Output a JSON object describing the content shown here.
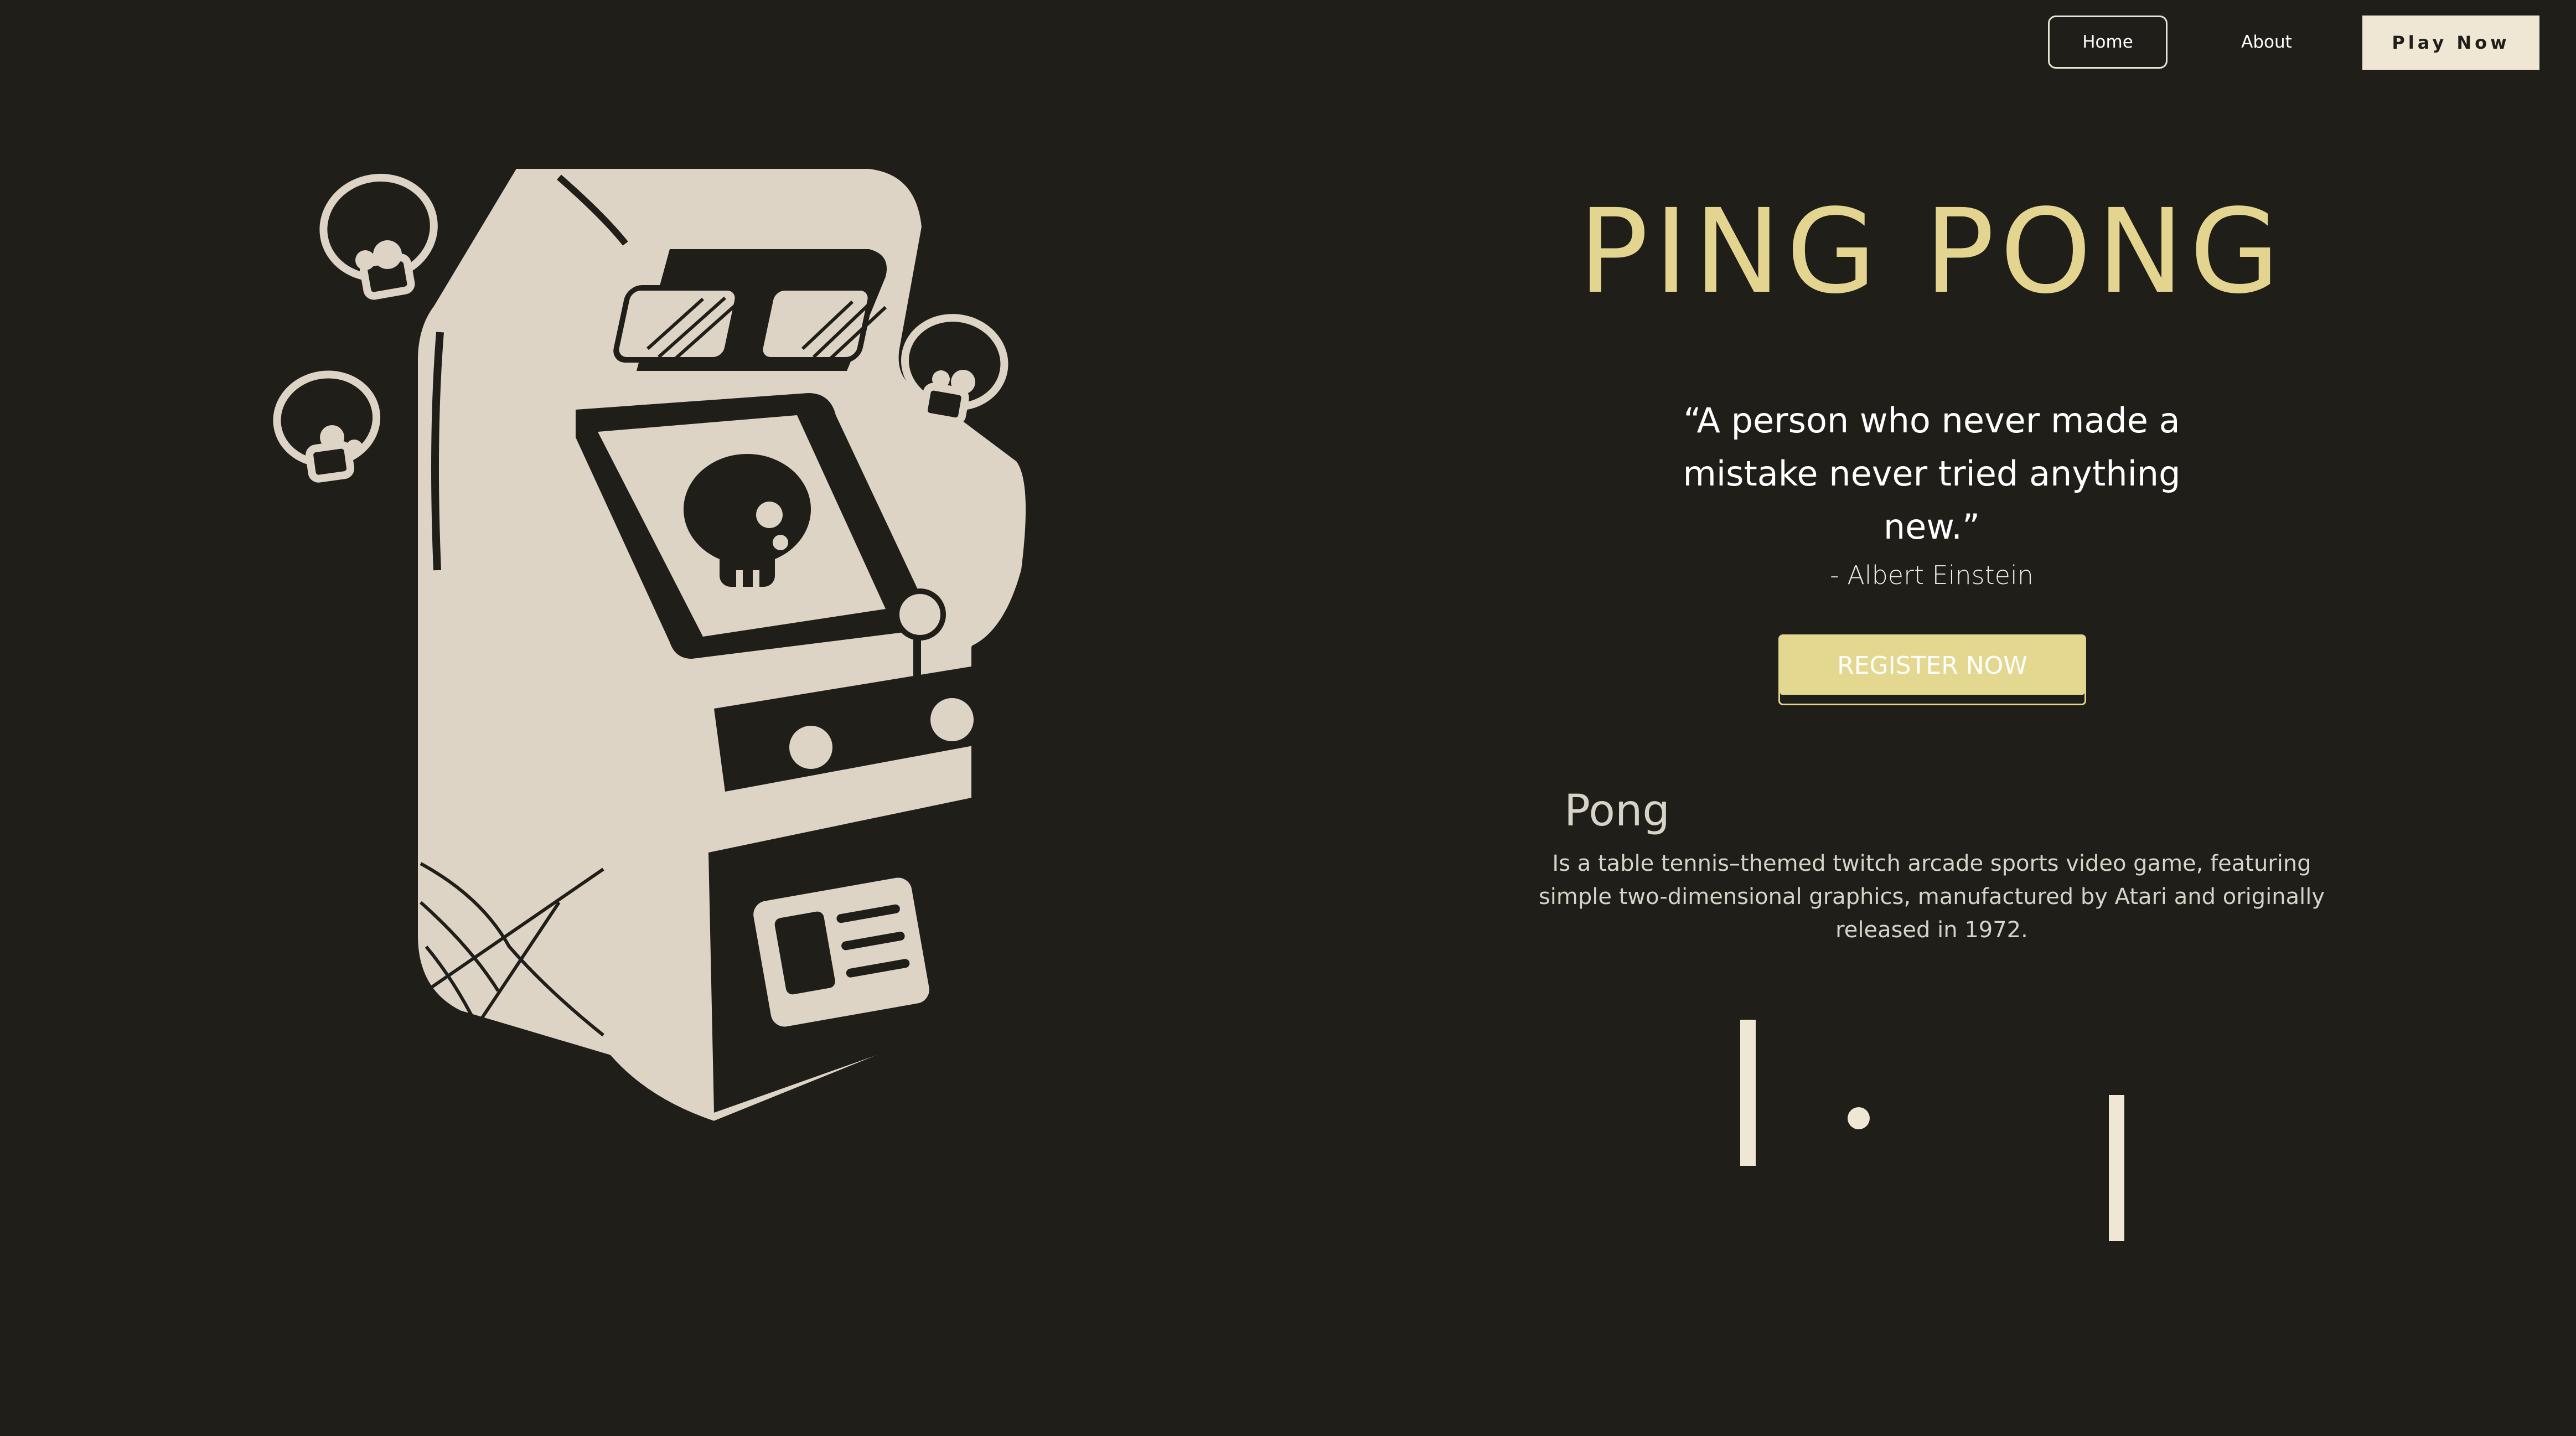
{
  "nav": {
    "home": "Home",
    "about": "About",
    "play": "Play Now"
  },
  "hero": {
    "title": "PING PONG",
    "quote": "“A person who never made a mistake never tried anything new.”",
    "author": "- Albert Einstein",
    "register_label": "REGISTER NOW"
  },
  "section": {
    "title": "Pong",
    "description": "Is a table tennis–themed twitch arcade sports video game, featuring simple two-dimensional graphics, manufactured by Atari and originally released in 1972."
  },
  "illustration": {
    "name": "arcade-cabinet-with-skulls",
    "colors": {
      "background": "#1f1e19",
      "cream": "#ddd4c6",
      "accent": "#e3d48f"
    }
  },
  "game_preview": {
    "left_paddle": "paddle",
    "right_paddle": "paddle",
    "ball": "ball"
  }
}
